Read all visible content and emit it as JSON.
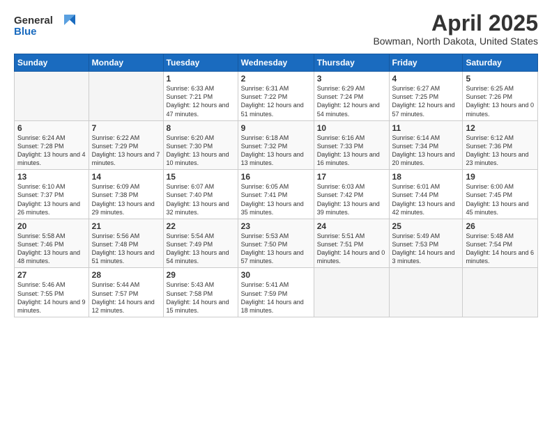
{
  "header": {
    "logo_line1": "General",
    "logo_line2": "Blue",
    "month": "April 2025",
    "location": "Bowman, North Dakota, United States"
  },
  "days_of_week": [
    "Sunday",
    "Monday",
    "Tuesday",
    "Wednesday",
    "Thursday",
    "Friday",
    "Saturday"
  ],
  "weeks": [
    [
      {
        "num": "",
        "info": ""
      },
      {
        "num": "",
        "info": ""
      },
      {
        "num": "1",
        "info": "Sunrise: 6:33 AM\nSunset: 7:21 PM\nDaylight: 12 hours and 47 minutes."
      },
      {
        "num": "2",
        "info": "Sunrise: 6:31 AM\nSunset: 7:22 PM\nDaylight: 12 hours and 51 minutes."
      },
      {
        "num": "3",
        "info": "Sunrise: 6:29 AM\nSunset: 7:24 PM\nDaylight: 12 hours and 54 minutes."
      },
      {
        "num": "4",
        "info": "Sunrise: 6:27 AM\nSunset: 7:25 PM\nDaylight: 12 hours and 57 minutes."
      },
      {
        "num": "5",
        "info": "Sunrise: 6:25 AM\nSunset: 7:26 PM\nDaylight: 13 hours and 0 minutes."
      }
    ],
    [
      {
        "num": "6",
        "info": "Sunrise: 6:24 AM\nSunset: 7:28 PM\nDaylight: 13 hours and 4 minutes."
      },
      {
        "num": "7",
        "info": "Sunrise: 6:22 AM\nSunset: 7:29 PM\nDaylight: 13 hours and 7 minutes."
      },
      {
        "num": "8",
        "info": "Sunrise: 6:20 AM\nSunset: 7:30 PM\nDaylight: 13 hours and 10 minutes."
      },
      {
        "num": "9",
        "info": "Sunrise: 6:18 AM\nSunset: 7:32 PM\nDaylight: 13 hours and 13 minutes."
      },
      {
        "num": "10",
        "info": "Sunrise: 6:16 AM\nSunset: 7:33 PM\nDaylight: 13 hours and 16 minutes."
      },
      {
        "num": "11",
        "info": "Sunrise: 6:14 AM\nSunset: 7:34 PM\nDaylight: 13 hours and 20 minutes."
      },
      {
        "num": "12",
        "info": "Sunrise: 6:12 AM\nSunset: 7:36 PM\nDaylight: 13 hours and 23 minutes."
      }
    ],
    [
      {
        "num": "13",
        "info": "Sunrise: 6:10 AM\nSunset: 7:37 PM\nDaylight: 13 hours and 26 minutes."
      },
      {
        "num": "14",
        "info": "Sunrise: 6:09 AM\nSunset: 7:38 PM\nDaylight: 13 hours and 29 minutes."
      },
      {
        "num": "15",
        "info": "Sunrise: 6:07 AM\nSunset: 7:40 PM\nDaylight: 13 hours and 32 minutes."
      },
      {
        "num": "16",
        "info": "Sunrise: 6:05 AM\nSunset: 7:41 PM\nDaylight: 13 hours and 35 minutes."
      },
      {
        "num": "17",
        "info": "Sunrise: 6:03 AM\nSunset: 7:42 PM\nDaylight: 13 hours and 39 minutes."
      },
      {
        "num": "18",
        "info": "Sunrise: 6:01 AM\nSunset: 7:44 PM\nDaylight: 13 hours and 42 minutes."
      },
      {
        "num": "19",
        "info": "Sunrise: 6:00 AM\nSunset: 7:45 PM\nDaylight: 13 hours and 45 minutes."
      }
    ],
    [
      {
        "num": "20",
        "info": "Sunrise: 5:58 AM\nSunset: 7:46 PM\nDaylight: 13 hours and 48 minutes."
      },
      {
        "num": "21",
        "info": "Sunrise: 5:56 AM\nSunset: 7:48 PM\nDaylight: 13 hours and 51 minutes."
      },
      {
        "num": "22",
        "info": "Sunrise: 5:54 AM\nSunset: 7:49 PM\nDaylight: 13 hours and 54 minutes."
      },
      {
        "num": "23",
        "info": "Sunrise: 5:53 AM\nSunset: 7:50 PM\nDaylight: 13 hours and 57 minutes."
      },
      {
        "num": "24",
        "info": "Sunrise: 5:51 AM\nSunset: 7:51 PM\nDaylight: 14 hours and 0 minutes."
      },
      {
        "num": "25",
        "info": "Sunrise: 5:49 AM\nSunset: 7:53 PM\nDaylight: 14 hours and 3 minutes."
      },
      {
        "num": "26",
        "info": "Sunrise: 5:48 AM\nSunset: 7:54 PM\nDaylight: 14 hours and 6 minutes."
      }
    ],
    [
      {
        "num": "27",
        "info": "Sunrise: 5:46 AM\nSunset: 7:55 PM\nDaylight: 14 hours and 9 minutes."
      },
      {
        "num": "28",
        "info": "Sunrise: 5:44 AM\nSunset: 7:57 PM\nDaylight: 14 hours and 12 minutes."
      },
      {
        "num": "29",
        "info": "Sunrise: 5:43 AM\nSunset: 7:58 PM\nDaylight: 14 hours and 15 minutes."
      },
      {
        "num": "30",
        "info": "Sunrise: 5:41 AM\nSunset: 7:59 PM\nDaylight: 14 hours and 18 minutes."
      },
      {
        "num": "",
        "info": ""
      },
      {
        "num": "",
        "info": ""
      },
      {
        "num": "",
        "info": ""
      }
    ]
  ]
}
